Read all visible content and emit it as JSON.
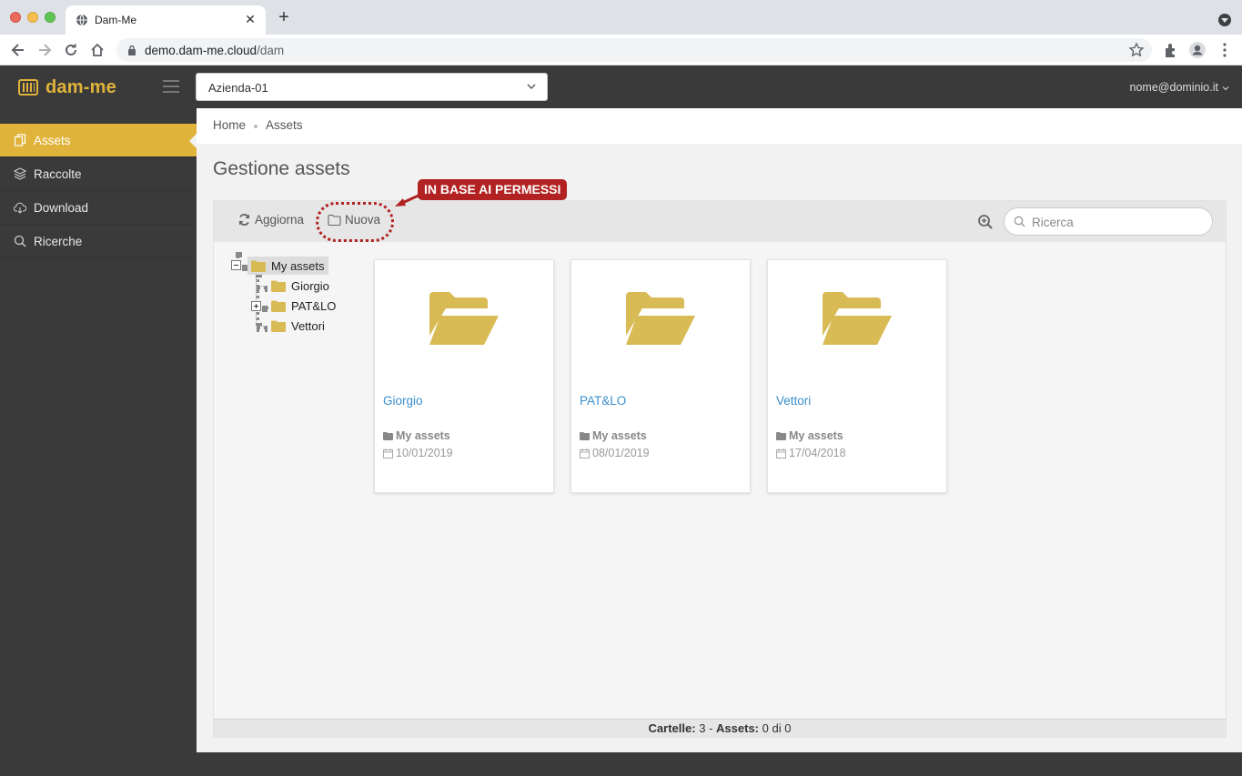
{
  "browser": {
    "tab_title": "Dam-Me",
    "url_host": "demo.dam-me.cloud",
    "url_path": "/dam"
  },
  "header": {
    "logo_text": "dam-me",
    "company_select_value": "Azienda-01",
    "user_email": "nome@dominio.it",
    "accent_color": "#e0b33a"
  },
  "sidebar": {
    "items": [
      {
        "label": "Assets",
        "icon": "copy-icon",
        "active": true
      },
      {
        "label": "Raccolte",
        "icon": "layers-icon",
        "active": false
      },
      {
        "label": "Download",
        "icon": "cloud-download-icon",
        "active": false
      },
      {
        "label": "Ricerche",
        "icon": "search-icon",
        "active": false
      }
    ]
  },
  "breadcrumb": {
    "items": [
      "Home",
      "Assets"
    ]
  },
  "page": {
    "title": "Gestione assets"
  },
  "toolbar": {
    "refresh_label": "Aggiorna",
    "new_label": "Nuova",
    "search_placeholder": "Ricerca"
  },
  "annotation": {
    "text": "IN BASE AI PERMESSI",
    "color": "#b22222"
  },
  "tree": {
    "root": "My assets",
    "children": [
      {
        "label": "Giorgio",
        "expandable": false
      },
      {
        "label": "PAT&LO",
        "expandable": true
      },
      {
        "label": "Vettori",
        "expandable": false
      }
    ]
  },
  "cards": [
    {
      "name": "Giorgio",
      "parent": "My assets",
      "date": "10/01/2019"
    },
    {
      "name": "PAT&LO",
      "parent": "My assets",
      "date": "08/01/2019"
    },
    {
      "name": "Vettori",
      "parent": "My assets",
      "date": "17/04/2018"
    }
  ],
  "footer": {
    "folders_label": "Cartelle:",
    "folders_count": "3",
    "separator": "-",
    "assets_label": "Assets:",
    "assets_value": "0 di 0"
  }
}
